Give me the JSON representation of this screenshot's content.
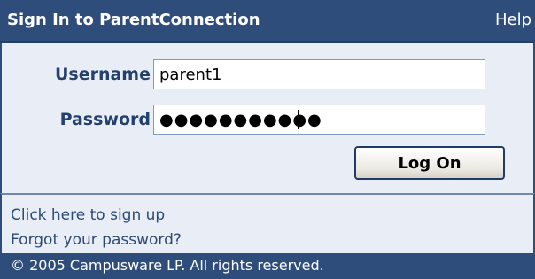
{
  "header": {
    "title": "Sign In to ParentConnection",
    "help_label": "Help"
  },
  "form": {
    "username_label": "Username",
    "username_value": "parent1",
    "password_label": "Password",
    "password_masked": "●●●●●●●●●●●",
    "logon_label": "Log On"
  },
  "links": {
    "signup": "Click here to sign up",
    "forgot_password": "Forgot your password?"
  },
  "footer": {
    "copyright": "© 2005 Campusware LP. All rights reserved."
  },
  "colors": {
    "header_bg": "#2e4d7b",
    "panel_bg": "#e9eef6",
    "label_color": "#24416e"
  }
}
